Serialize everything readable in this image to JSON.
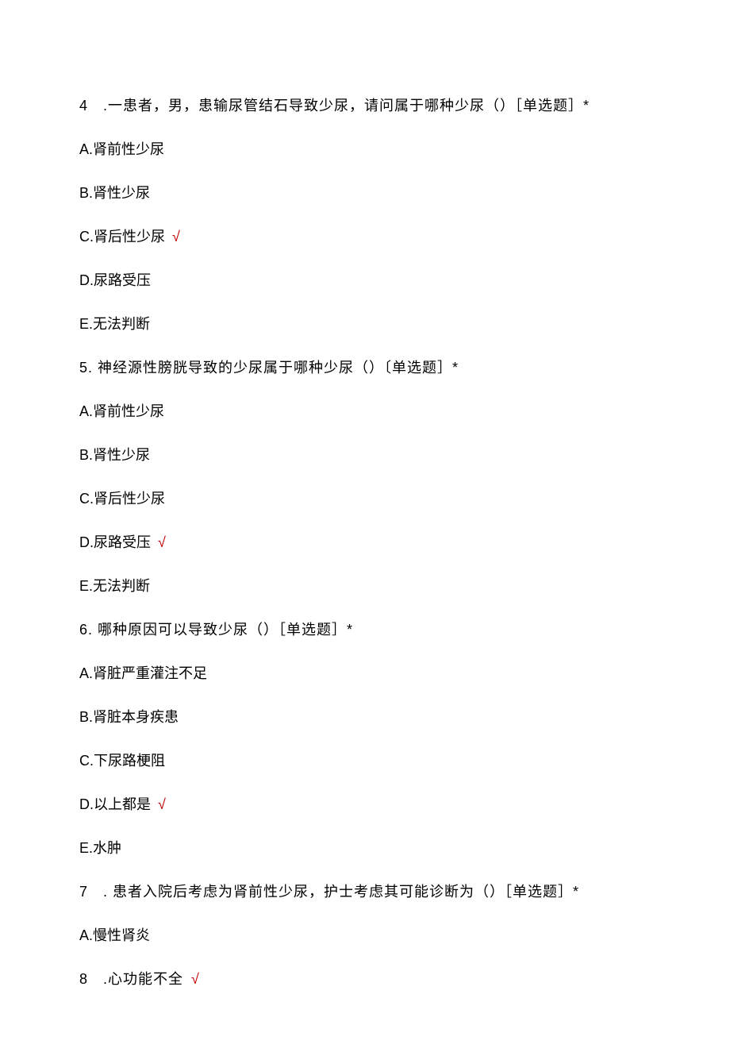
{
  "checkmark": "√",
  "questions": [
    {
      "number": "4",
      "text": "　.一患者，男，患输尿管结石导致少尿，请问属于哪种少尿（）［单选题］*",
      "options": [
        {
          "label": "A.肾前性少尿",
          "correct": false
        },
        {
          "label": "B.肾性少尿",
          "correct": false
        },
        {
          "label": "C.肾后性少尿",
          "correct": true
        },
        {
          "label": "D.尿路受压",
          "correct": false
        },
        {
          "label": "E.无法判断",
          "correct": false
        }
      ]
    },
    {
      "number": "5.",
      "text": " 神经源性膀胱导致的少尿属于哪种少尿（）〔单选题］*",
      "options": [
        {
          "label": "A.肾前性少尿",
          "correct": false
        },
        {
          "label": "B.肾性少尿",
          "correct": false
        },
        {
          "label": "C.肾后性少尿",
          "correct": false
        },
        {
          "label": "D.尿路受压",
          "correct": true
        },
        {
          "label": "E.无法判断",
          "correct": false
        }
      ]
    },
    {
      "number": "6.",
      "text": " 哪种原因可以导致少尿（）［单选题］*",
      "options": [
        {
          "label": "A.肾脏严重灌注不足",
          "correct": false
        },
        {
          "label": "B.肾脏本身疾患",
          "correct": false
        },
        {
          "label": "C.下尿路梗阻",
          "correct": false
        },
        {
          "label": "D.以上都是",
          "correct": true
        },
        {
          "label": "E.水肿",
          "correct": false
        }
      ]
    },
    {
      "number": "7",
      "text": "　. 患者入院后考虑为肾前性少尿，护士考虑其可能诊断为（）［单选题］*",
      "options": [
        {
          "label": "A.慢性肾炎",
          "correct": false
        }
      ]
    },
    {
      "number": "8",
      "text": "　.心功能不全",
      "correct_inline": true,
      "options": []
    }
  ]
}
